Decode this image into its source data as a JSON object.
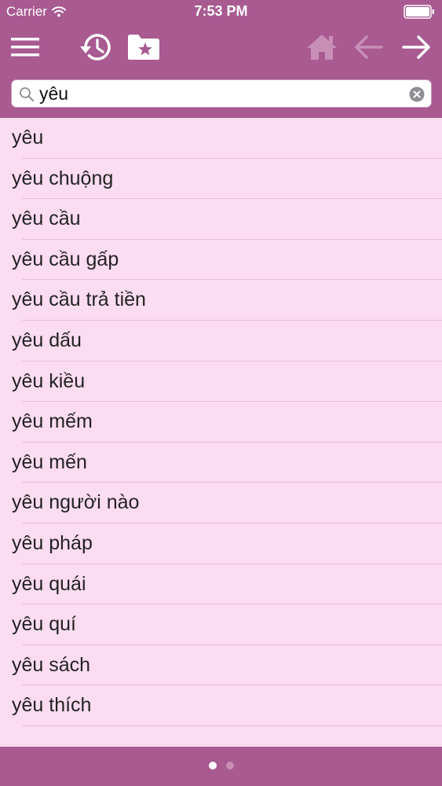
{
  "status_bar": {
    "carrier": "Carrier",
    "time": "7:53 PM",
    "icons": [
      "wifi-icon",
      "battery-icon"
    ]
  },
  "toolbar": {
    "icons": [
      "menu-icon",
      "history-icon",
      "favorites-folder-icon",
      "home-icon",
      "back-arrow-icon",
      "forward-arrow-icon"
    ]
  },
  "search": {
    "value": "yêu",
    "icons": [
      "search-icon",
      "clear-icon"
    ]
  },
  "results": [
    "yêu",
    "yêu chuộng",
    "yêu cầu",
    "yêu cầu gấp",
    "yêu cầu trả tiền",
    "yêu dấu",
    "yêu kiều",
    "yêu mếm",
    "yêu mến",
    "yêu người nào",
    "yêu pháp",
    "yêu quái",
    "yêu quí",
    "yêu sách",
    "yêu thích"
  ],
  "pager": {
    "current_page": 1,
    "page_count": 2
  },
  "colors": {
    "bar": "#a85a91",
    "list_background": "#fcdcf0",
    "separator": "#e6bfd6",
    "icon_active": "#ffffff",
    "icon_disabled": "#c98fb7"
  }
}
